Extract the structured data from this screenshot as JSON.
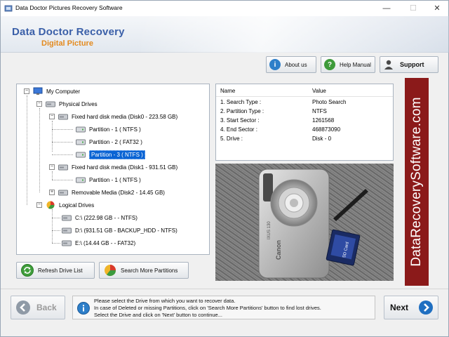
{
  "window": {
    "title": "Data Doctor Pictures Recovery Software",
    "controls": {
      "minimize": "—",
      "maximize": "☐",
      "close": "✕"
    }
  },
  "banner": {
    "brand_line1": "Data Doctor Recovery",
    "brand_line2": "Digital Picture"
  },
  "toolbar": {
    "about_label": "About us",
    "help_label": "Help Manual",
    "support_label": "Support"
  },
  "tree": {
    "my_computer": "My Computer",
    "physical_drives": "Physical Drives",
    "disk0": "Fixed hard disk media (Disk0 - 223.58 GB)",
    "disk0_p1": "Partition - 1 ( NTFS )",
    "disk0_p2": "Partition - 2 ( FAT32 )",
    "disk0_p3": "Partition - 3 ( NTFS )",
    "disk1": "Fixed hard disk media (Disk1 - 931.51 GB)",
    "disk1_p1": "Partition - 1 ( NTFS )",
    "disk2": "Removable Media (Disk2 - 14.45 GB)",
    "logical_drives": "Logical Drives",
    "drive_c": "C:\\ (222.98 GB -  - NTFS)",
    "drive_d": "D:\\ (931.51 GB - BACKUP_HDD - NTFS)",
    "drive_e": "E:\\ (14.44 GB -  - FAT32)",
    "selected": "disk0_p3"
  },
  "info_table": {
    "col_name": "Name",
    "col_value": "Value",
    "rows": [
      {
        "name": "1. Search Type :",
        "value": "Photo Search"
      },
      {
        "name": "2. Partition Type :",
        "value": "NTFS"
      },
      {
        "name": "3. Start Sector :",
        "value": "1261568"
      },
      {
        "name": "4. End Sector :",
        "value": "468873090"
      },
      {
        "name": "5. Drive :",
        "value": "Disk - 0"
      }
    ]
  },
  "photo": {
    "brand": "Canon",
    "model": "IXUS 130",
    "card": "SD Card"
  },
  "vertical_logo": "DataRecoverySoftware.com",
  "actions": {
    "refresh_label": "Refresh Drive List",
    "search_more_label": "Search More Partitions"
  },
  "footer": {
    "back_label": "Back",
    "next_label": "Next",
    "message_line1": "Please select the Drive from which you want to recover data.",
    "message_line2": "In case of Deleted or missing Partitions, click on 'Search More Partitions' button to find lost drives.",
    "message_line3": "Select the Drive and click on 'Next' button to continue..."
  },
  "colors": {
    "brand_blue": "#3a5fa8",
    "brand_orange": "#e38a1e",
    "logo_red": "#8b1a1a",
    "selection": "#0a64d4"
  }
}
